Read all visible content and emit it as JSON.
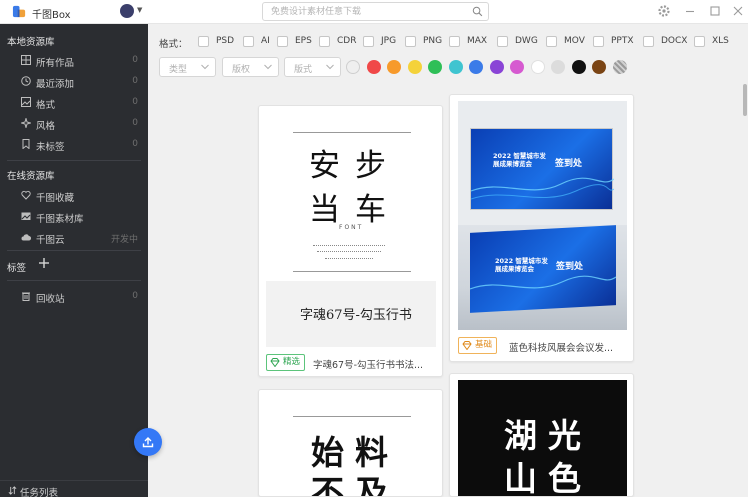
{
  "app": {
    "title": "千图Box"
  },
  "search": {
    "placeholder": "免费设计素材任意下载"
  },
  "sidebar": {
    "local_section": "本地资源库",
    "local_items": [
      {
        "label": "所有作品",
        "count": "0",
        "icon": "grid-icon"
      },
      {
        "label": "最近添加",
        "count": "0",
        "icon": "clock-icon"
      },
      {
        "label": "格式",
        "count": "0",
        "icon": "image-icon"
      },
      {
        "label": "风格",
        "count": "0",
        "icon": "style-icon"
      },
      {
        "label": "未标签",
        "count": "0",
        "icon": "bookmark-icon"
      }
    ],
    "online_section": "在线资源库",
    "online_items": [
      {
        "label": "千图收藏",
        "count": "",
        "icon": "heart-icon"
      },
      {
        "label": "千图素材库",
        "count": "",
        "icon": "gallery-icon"
      },
      {
        "label": "千图云",
        "count": "开发中",
        "icon": "cloud-icon"
      }
    ],
    "tags_section": "标签",
    "trash": {
      "label": "回收站",
      "count": "0"
    },
    "task_list": "任务列表"
  },
  "filters": {
    "format_label": "格式：",
    "formats": [
      "PSD",
      "AI",
      "EPS",
      "CDR",
      "JPG",
      "PNG",
      "MAX",
      "DWG",
      "MOV",
      "PPTX",
      "DOCX",
      "XLS"
    ],
    "dropdowns": [
      "类型",
      "版权",
      "版式"
    ],
    "colors": [
      "#e8e8e8",
      "#f04848",
      "#f79a2b",
      "#f4d23a",
      "#2fbf57",
      "#3fc4d0",
      "#3b7be8",
      "#8a44d6",
      "#d65ad0",
      "#ffffff",
      "#dcdcdc",
      "#111111",
      "#7a4414",
      "#9a9a9a"
    ]
  },
  "cards": [
    {
      "badge": "精选",
      "title": "字魂67号-勾玉行书书法...",
      "font_chars": [
        "安",
        "步",
        "当",
        "车"
      ],
      "font_label": "FONT",
      "sample_text": "字魂67号-勾玉行书"
    },
    {
      "badge": "基础",
      "title": "蓝色科技风展会会议发...",
      "board_title": "2022 智慧城市发展成果博览会",
      "board_sub": "签到处"
    },
    {
      "title": "",
      "chars": [
        "始",
        "料",
        "不",
        "及"
      ]
    },
    {
      "title": "",
      "chars": [
        "湖",
        "光",
        "山",
        "色"
      ]
    }
  ]
}
